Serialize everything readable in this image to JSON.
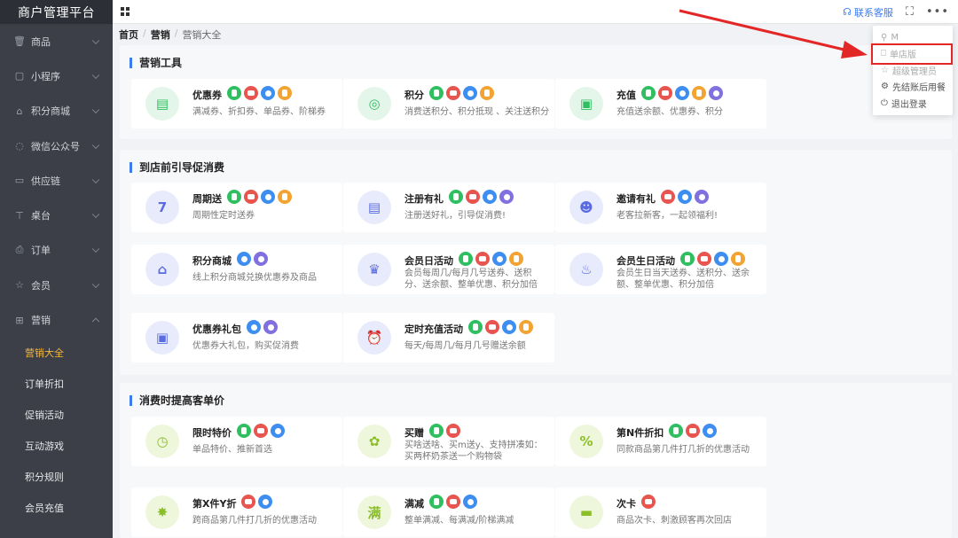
{
  "app": {
    "title": "商户管理平台"
  },
  "sidebar": {
    "items": [
      {
        "label": "商品",
        "icon": "trash-icon"
      },
      {
        "label": "小程序",
        "icon": "square-icon"
      },
      {
        "label": "积分商城",
        "icon": "shop-icon"
      },
      {
        "label": "微信公众号",
        "icon": "chat-icon"
      },
      {
        "label": "供应链",
        "icon": "truck-icon"
      },
      {
        "label": "桌台",
        "icon": "table-icon"
      },
      {
        "label": "订单",
        "icon": "printer-icon"
      },
      {
        "label": "会员",
        "icon": "star-icon"
      },
      {
        "label": "营销",
        "icon": "gift-icon"
      }
    ],
    "sub_items": [
      {
        "label": "营销大全",
        "active": true
      },
      {
        "label": "订单折扣"
      },
      {
        "label": "促销活动"
      },
      {
        "label": "互动游戏"
      },
      {
        "label": "积分规则"
      },
      {
        "label": "会员充值"
      }
    ]
  },
  "topbar": {
    "service_label": "联系客服",
    "fullscreen_icon": "fullscreen-icon",
    "more_icon": "more-icon"
  },
  "breadcrumb": [
    "首页",
    "营销",
    "营销大全"
  ],
  "dropdown": {
    "user_label": "M",
    "items": [
      {
        "label": "单店版",
        "icon": "bookmark-icon"
      },
      {
        "label": "超级管理员",
        "icon": "star-icon"
      },
      {
        "label": "先结账后用餐",
        "icon": "gear-icon"
      },
      {
        "label": "退出登录",
        "icon": "power-icon"
      }
    ]
  },
  "sections": [
    {
      "title": "营销工具",
      "cards": [
        {
          "name": "优惠券",
          "desc": "满减券、折扣券、单品券、阶梯券",
          "icon": "coupon-icon",
          "icon_color": "#2fbf60",
          "badges": [
            "green",
            "red",
            "blue",
            "orange"
          ]
        },
        {
          "name": "积分",
          "desc": "消费送积分、积分抵现 、关注送积分",
          "icon": "coins-icon",
          "icon_color": "#2fbf60",
          "badges": [
            "green",
            "red",
            "blue",
            "orange"
          ]
        },
        {
          "name": "充值",
          "desc": "充值送余额、优惠券、积分",
          "icon": "recharge-icon",
          "icon_color": "#2fbf60",
          "badges": [
            "green",
            "red",
            "blue",
            "orange",
            "purple"
          ]
        }
      ]
    },
    {
      "title": "到店前引导促消费",
      "cards": [
        {
          "name": "周期送",
          "desc": "周期性定时送券",
          "icon": "calendar-icon",
          "icon_color": "#5b6be0",
          "badges": [
            "green",
            "red",
            "blue",
            "orange"
          ]
        },
        {
          "name": "注册有礼",
          "desc": "注册送好礼，引导促消费!",
          "icon": "register-icon",
          "icon_color": "#5b6be0",
          "badges": [
            "green",
            "red",
            "blue",
            "purple"
          ]
        },
        {
          "name": "邀请有礼",
          "desc": "老客拉新客，一起领福利!",
          "icon": "invite-icon",
          "icon_color": "#5b6be0",
          "badges": [
            "red",
            "blue",
            "purple"
          ]
        },
        {
          "name": "积分商城",
          "desc": "线上积分商城兑换优惠券及商品",
          "icon": "store-icon",
          "icon_color": "#5b6be0",
          "badges": [
            "blue",
            "purple"
          ]
        },
        {
          "name": "会员日活动",
          "desc": "会员每周几/每月几号送券、送积分、送余额、整单优惠、积分加倍",
          "icon": "crown-icon",
          "icon_color": "#5b6be0",
          "badges": [
            "green",
            "red",
            "blue",
            "orange"
          ]
        },
        {
          "name": "会员生日活动",
          "desc": "会员生日当天送券、送积分、送余额、整单优惠、积分加倍",
          "icon": "cake-icon",
          "icon_color": "#5b6be0",
          "badges": [
            "green",
            "red",
            "blue",
            "orange"
          ]
        },
        {
          "name": "优惠券礼包",
          "desc": "优惠券大礼包，购买促消费",
          "icon": "wallet-icon",
          "icon_color": "#5b6be0",
          "badges": [
            "blue",
            "purple"
          ]
        },
        {
          "name": "定时充值活动",
          "desc": "每天/每周几/每月几号赠送余额",
          "icon": "alarm-icon",
          "icon_color": "#5b6be0",
          "badges": [
            "green",
            "red",
            "blue",
            "orange"
          ]
        }
      ]
    },
    {
      "title": "消费时提高客单价",
      "cards": [
        {
          "name": "限时特价",
          "desc": "单品特价、推新首选",
          "icon": "timer-icon",
          "icon_color": "#8bbf2a",
          "badges": [
            "green",
            "red",
            "blue"
          ]
        },
        {
          "name": "买赠",
          "desc": "买啥送啥、买m送y、支持拼凑如：买两杯奶茶送一个购物袋",
          "icon": "gift-hand-icon",
          "icon_color": "#8bbf2a",
          "badges": [
            "green",
            "red"
          ]
        },
        {
          "name": "第N件折扣",
          "desc": "同款商品第几件打几折的优惠活动",
          "icon": "percent-icon",
          "icon_color": "#8bbf2a",
          "badges": [
            "green",
            "red",
            "blue"
          ]
        },
        {
          "name": "第X件Y折",
          "desc": "跨商品第几件打几折的优惠活动",
          "icon": "discount-icon",
          "icon_color": "#8bbf2a",
          "badges": [
            "red",
            "blue"
          ]
        },
        {
          "name": "满减",
          "desc": "整单满减、每满减/阶梯满减",
          "icon": "full-reduce-icon",
          "icon_color": "#8bbf2a",
          "badges": [
            "green",
            "red",
            "blue"
          ]
        },
        {
          "name": "次卡",
          "desc": "商品次卡、刺激顾客再次回店",
          "icon": "card-icon",
          "icon_color": "#8bbf2a",
          "badges": [
            "red"
          ]
        }
      ]
    }
  ]
}
